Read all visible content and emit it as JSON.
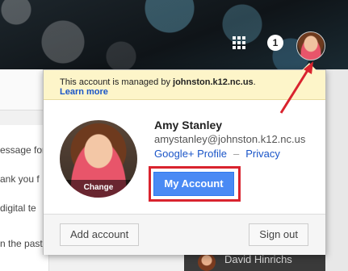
{
  "topbar": {
    "notification_count": "1",
    "apps_icon": "apps-grid-icon",
    "avatar_icon": "user-avatar"
  },
  "mail_snippets": [
    "essage for",
    "ank you f",
    "digital te",
    "",
    "n the past"
  ],
  "chat": {
    "name": "David Hinrichs"
  },
  "popup": {
    "managed_prefix": "This account is managed by ",
    "managed_domain": "johnston.k12.nc.us",
    "managed_suffix": ".",
    "learn_more": "Learn more",
    "change_label": "Change",
    "name": "Amy Stanley",
    "email": "amystanley@johnston.k12.nc.us",
    "profile_link": "Google+ Profile",
    "separator": "–",
    "privacy_link": "Privacy",
    "my_account": "My Account",
    "add_account": "Add account",
    "sign_out": "Sign out"
  },
  "colors": {
    "accent": "#4a8af4",
    "highlight": "#d9232e",
    "banner": "#fdf5c9"
  }
}
